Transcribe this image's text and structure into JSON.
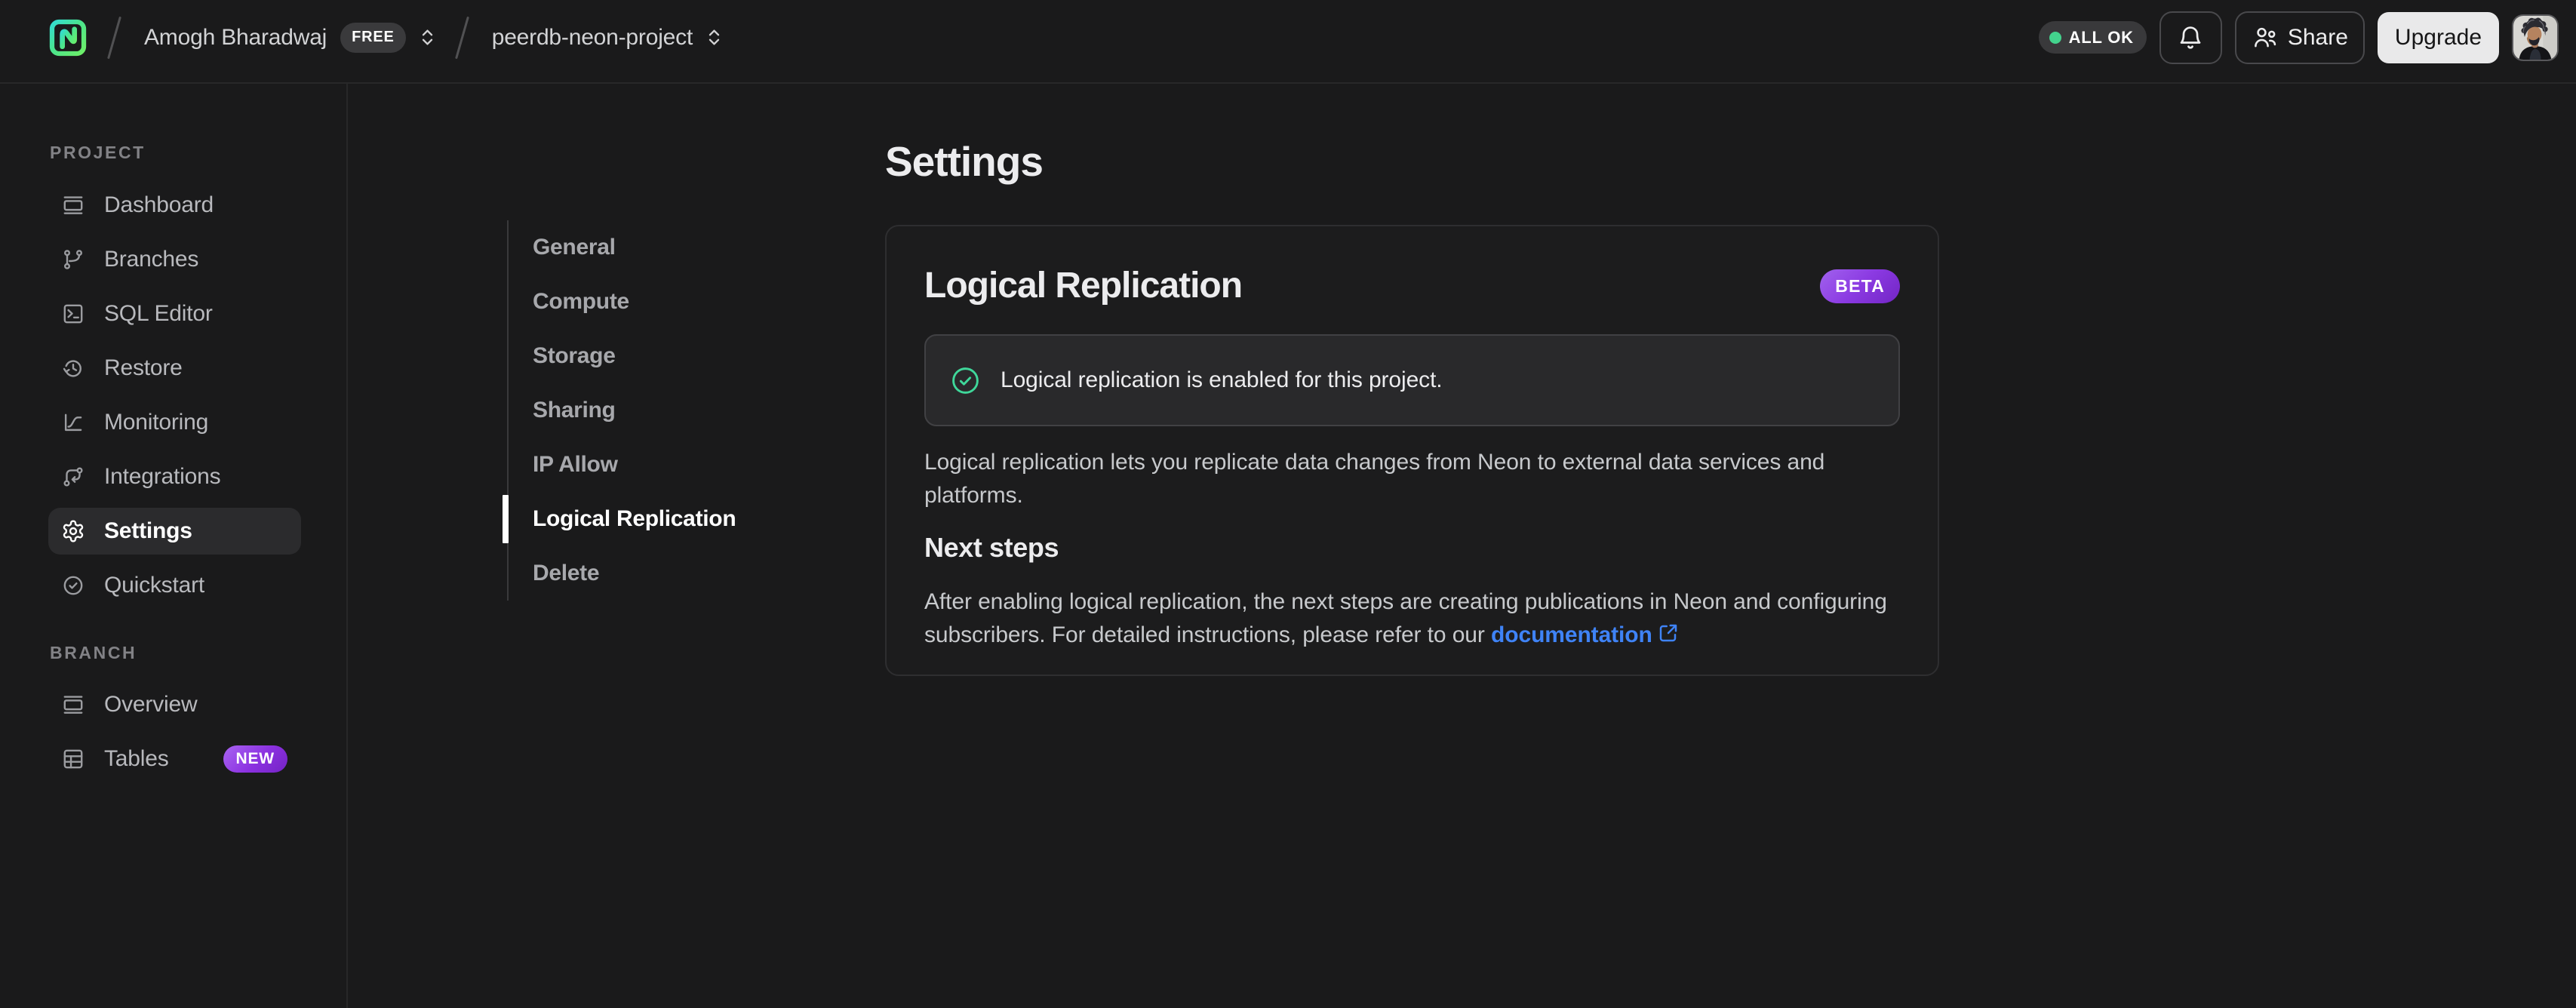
{
  "topbar": {
    "logo_icon": "neon-logo",
    "breadcrumb": {
      "org_name": "Amogh Bharadwaj",
      "org_plan_badge": "FREE",
      "project_name": "peerdb-neon-project"
    },
    "status_pill_label": "ALL OK",
    "share_label": "Share",
    "upgrade_label": "Upgrade"
  },
  "sidebar": {
    "sections": [
      {
        "label": "PROJECT",
        "items": [
          {
            "label": "Dashboard",
            "icon": "dashboard-icon"
          },
          {
            "label": "Branches",
            "icon": "branches-icon"
          },
          {
            "label": "SQL Editor",
            "icon": "sql-editor-icon"
          },
          {
            "label": "Restore",
            "icon": "restore-icon"
          },
          {
            "label": "Monitoring",
            "icon": "monitoring-icon"
          },
          {
            "label": "Integrations",
            "icon": "integrations-icon"
          },
          {
            "label": "Settings",
            "icon": "settings-icon",
            "active": true
          },
          {
            "label": "Quickstart",
            "icon": "quickstart-icon"
          }
        ]
      },
      {
        "label": "BRANCH",
        "items": [
          {
            "label": "Overview",
            "icon": "overview-icon"
          },
          {
            "label": "Tables",
            "icon": "tables-icon",
            "badge": "NEW"
          }
        ]
      }
    ]
  },
  "page": {
    "title": "Settings"
  },
  "settings_nav": {
    "items": [
      "General",
      "Compute",
      "Storage",
      "Sharing",
      "IP Allow",
      "Logical Replication",
      "Delete"
    ],
    "active": "Logical Replication"
  },
  "card": {
    "title": "Logical Replication",
    "badge": "BETA",
    "banner_text": "Logical replication is enabled for this project.",
    "description": "Logical replication lets you replicate data changes from Neon to external data services and platforms.",
    "next_steps_title": "Next steps",
    "next_steps_text": "After enabling logical replication, the next steps are creating publications in Neon and configuring subscribers. For detailed instructions, please refer to our ",
    "link_label": "documentation"
  },
  "colors": {
    "background": "#1a1a1b",
    "accent_green": "#43d38d",
    "badge_purple": "#8b31e0",
    "link_blue": "#3f83f6"
  }
}
